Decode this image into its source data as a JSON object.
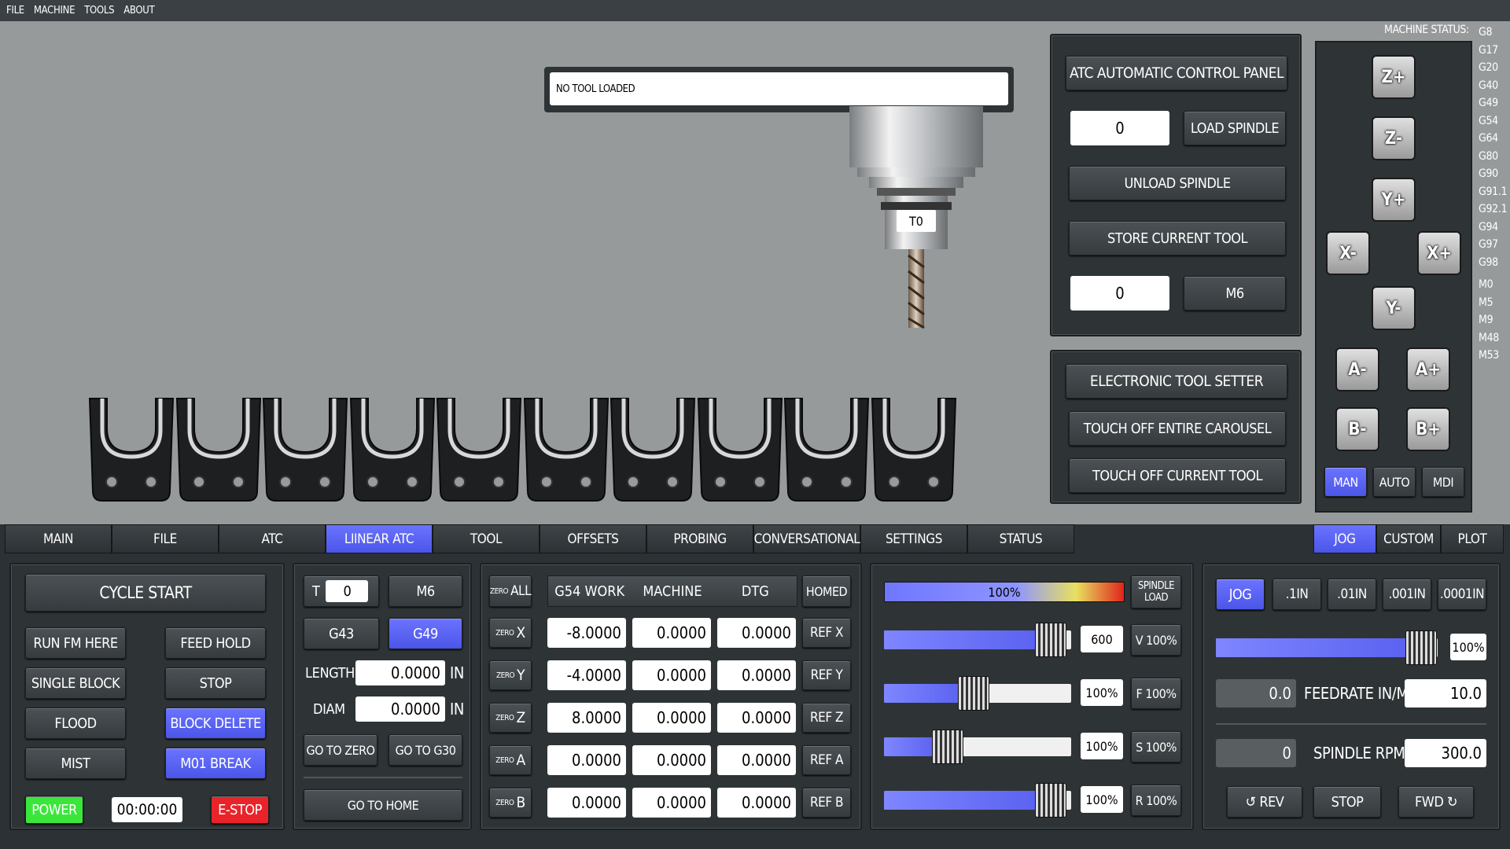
{
  "menu": [
    "FILE",
    "MACHINE",
    "TOOLS",
    "ABOUT"
  ],
  "toolbox": {
    "text": "NO TOOL LOADED"
  },
  "spindle": {
    "tool_label": "T0"
  },
  "atc": {
    "title": "ATC AUTOMATIC CONTROL PANEL",
    "tool_value": "0",
    "load_spindle": "LOAD SPINDLE",
    "unload_spindle": "UNLOAD SPINDLE",
    "store_current_tool": "STORE CURRENT TOOL",
    "m6_value": "0",
    "m6_label": "M6"
  },
  "tool_setter": {
    "title": "ELECTRONIC TOOL SETTER",
    "touch_carousel": "TOUCH OFF ENTIRE CAROUSEL",
    "touch_current": "TOUCH OFF CURRENT TOOL"
  },
  "status": {
    "label": "MACHINE STATUS:",
    "codes": [
      "G8",
      "G17",
      "G20",
      "G40",
      "G49",
      "G54",
      "G64",
      "G80",
      "G90",
      "G91.1",
      "G92.1",
      "G94",
      "G97",
      "G98",
      "M0",
      "M5",
      "M9",
      "M48",
      "M53"
    ]
  },
  "jog_buttons": {
    "zp": "Z+",
    "zm": "Z-",
    "yp": "Y+",
    "xm": "X-",
    "xp": "X+",
    "ym": "Y-",
    "am": "A-",
    "ap": "A+",
    "bm": "B-",
    "bp": "B+"
  },
  "modes": {
    "man": "MAN",
    "auto": "AUTO",
    "mdi": "MDI"
  },
  "tabs": [
    "MAIN",
    "FILE",
    "ATC",
    "LIINEAR ATC",
    "TOOL",
    "OFFSETS",
    "PROBING",
    "CONVERSATIONAL",
    "SETTINGS",
    "STATUS"
  ],
  "right_tabs": [
    "JOG",
    "CUSTOM",
    "PLOT"
  ],
  "controls": {
    "cycle_start": "CYCLE START",
    "run_from_here": "RUN FM HERE",
    "feed_hold": "FEED HOLD",
    "single_block": "SINGLE BLOCK",
    "stop": "STOP",
    "flood": "FLOOD",
    "block_delete": "BLOCK DELETE",
    "mist": "MIST",
    "m01_break": "M01 BREAK",
    "power": "POWER",
    "timer": "00:00:00",
    "estop": "E-STOP"
  },
  "tool_panel": {
    "t_label": "T",
    "t_value": "0",
    "m6": "M6",
    "g43": "G43",
    "g49": "G49",
    "length_label": "LENGTH",
    "length_value": "0.0000",
    "diam_label": "DIAM",
    "diam_value": "0.0000",
    "unit": "IN",
    "go_to_zero": "GO TO ZERO",
    "go_to_g30": "GO TO G30",
    "go_to_home": "GO TO HOME"
  },
  "dro": {
    "zero_all_small": "ZERO",
    "zero_all_big": "ALL",
    "headers": [
      "G54 WORK",
      "MACHINE",
      "DTG"
    ],
    "homed": "HOMED",
    "rows": [
      {
        "axis": "X",
        "work": "-8.0000",
        "machine": "0.0000",
        "dtg": "0.0000",
        "ref": "REF X"
      },
      {
        "axis": "Y",
        "work": "-4.0000",
        "machine": "0.0000",
        "dtg": "0.0000",
        "ref": "REF Y"
      },
      {
        "axis": "Z",
        "work": "8.0000",
        "machine": "0.0000",
        "dtg": "0.0000",
        "ref": "REF Z"
      },
      {
        "axis": "A",
        "work": "0.0000",
        "machine": "0.0000",
        "dtg": "0.0000",
        "ref": "REF A"
      },
      {
        "axis": "B",
        "work": "0.0000",
        "machine": "0.0000",
        "dtg": "0.0000",
        "ref": "REF B"
      }
    ]
  },
  "overrides": {
    "spindle_load_pct": "100%",
    "spindle_load_label": "SPINDLE LOAD",
    "rows": [
      {
        "value": "600",
        "button": "V 100%",
        "fill": 0.83
      },
      {
        "value": "100%",
        "button": "F 100%",
        "fill": 0.42
      },
      {
        "value": "100%",
        "button": "S 100%",
        "fill": 0.28
      },
      {
        "value": "100%",
        "button": "R 100%",
        "fill": 0.83
      }
    ]
  },
  "jog": {
    "jog": "JOG",
    "steps": [
      ".1IN",
      ".01IN",
      ".001IN",
      ".0001IN"
    ],
    "jog_pct": "100%",
    "jog_fill": 0.87,
    "feed_value": "0.0",
    "feed_label": "FEEDRATE IN/M",
    "feed_set": "10.0",
    "rpm_value": "0",
    "rpm_label": "SPINDLE RPM",
    "rpm_set": "300.0",
    "rev": "↺ REV",
    "stop": "STOP",
    "fwd": "FWD ↻"
  },
  "colors": {
    "accent": "#5a62f0",
    "bg": "#2b3134",
    "viewport": "#979a9b"
  }
}
